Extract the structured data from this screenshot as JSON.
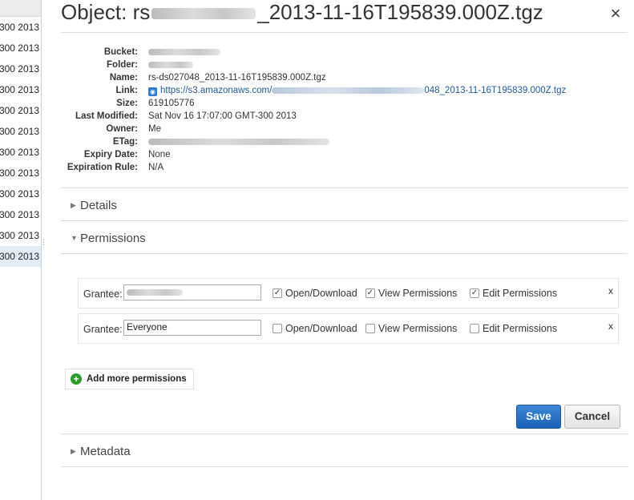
{
  "left_list": {
    "rows": [
      {
        "text": "300 2013"
      },
      {
        "text": "300 2013"
      },
      {
        "text": "300 2013"
      },
      {
        "text": "300 2013"
      },
      {
        "text": "300 2013"
      },
      {
        "text": "300 2013"
      },
      {
        "text": "300 2013"
      },
      {
        "text": "300 2013"
      },
      {
        "text": "300 2013"
      },
      {
        "text": "300 2013"
      },
      {
        "text": "300 2013"
      },
      {
        "text": "300 2013"
      }
    ]
  },
  "panel": {
    "title_prefix": "Object: rs",
    "title_suffix": "_2013-11-16T195839.000Z.tgz",
    "close_glyph": "×"
  },
  "properties": {
    "bucket_label": "Bucket:",
    "folder_label": "Folder:",
    "name_label": "Name:",
    "name_value": "rs-ds027048_2013-11-16T195839.000Z.tgz",
    "link_label": "Link:",
    "link_prefix": "https://s3.amazonaws.com/",
    "link_suffix": "048_2013-11-16T195839.000Z.tgz",
    "size_label": "Size:",
    "size_value": "619105776",
    "last_modified_label": "Last Modified:",
    "last_modified_value": "Sat Nov 16 17:07:00 GMT-300 2013",
    "owner_label": "Owner:",
    "owner_value": "Me",
    "etag_label": "ETag:",
    "expiry_label": "Expiry Date:",
    "expiry_value": "None",
    "expiration_rule_label": "Expiration Rule:",
    "expiration_rule_value": "N/A"
  },
  "sections": {
    "details": "Details",
    "permissions": "Permissions",
    "metadata": "Metadata"
  },
  "permissions": {
    "grantee_label": "Grantee:",
    "open_download": "Open/Download",
    "view_permissions": "View Permissions",
    "edit_permissions": "Edit Permissions",
    "remove_glyph": "x",
    "row2_grantee": "Everyone",
    "add_more": "Add more permissions"
  },
  "buttons": {
    "save": "Save",
    "cancel": "Cancel"
  }
}
